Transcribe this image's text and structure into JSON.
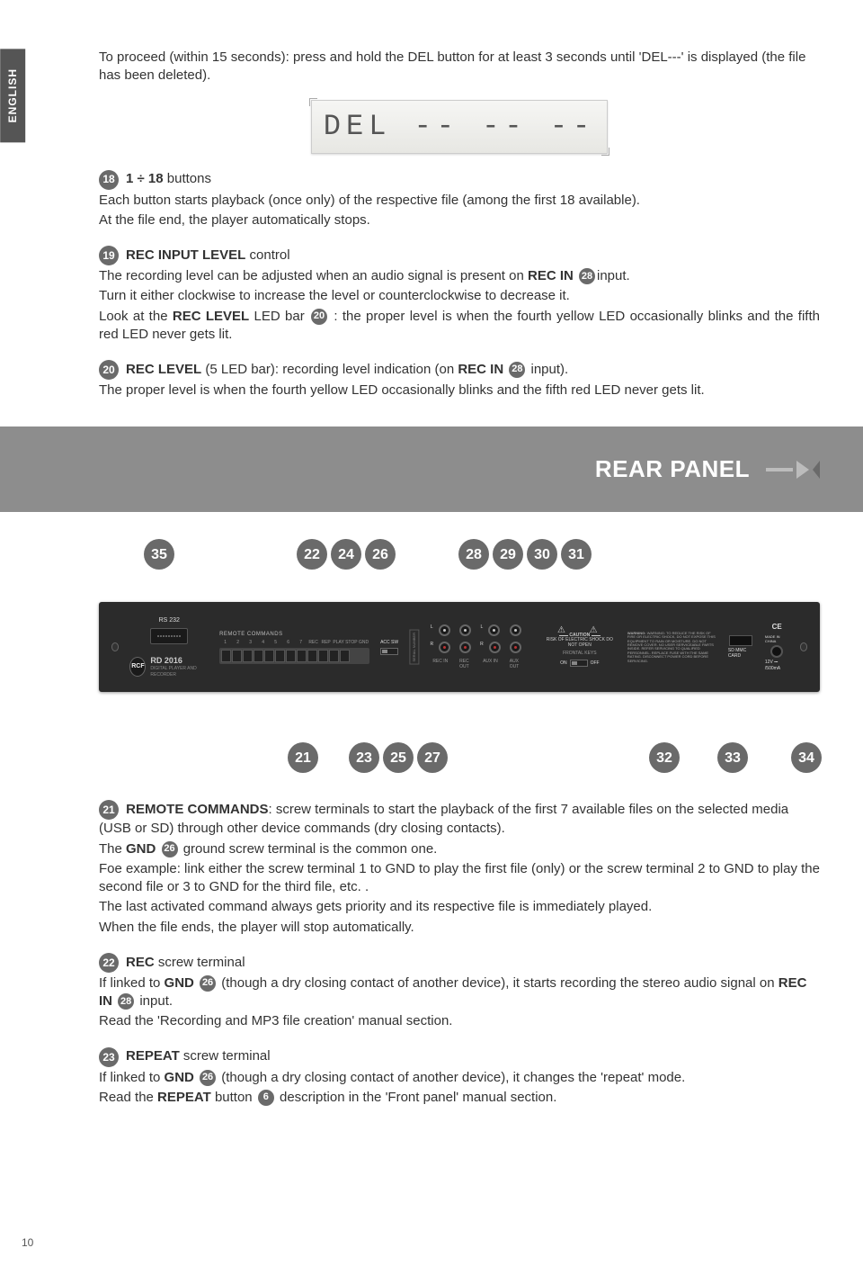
{
  "lang_tab": "ENGLISH",
  "intro": "To proceed (within 15 seconds): press and hold the DEL button for at least 3 seconds until 'DEL---' is displayed (the file has been deleted).",
  "lcd": "DEL -- -- --",
  "s18": {
    "num": "18",
    "head_a": "1 ÷ 18",
    "head_b": " buttons",
    "p1": "Each button starts playback (once only) of the respective file (among the first 18 available).",
    "p2": "At the file end, the player automatically stops."
  },
  "s19": {
    "num": "19",
    "head_a": "REC INPUT LEVEL",
    "head_b": " control",
    "p1a": "The recording level can be adjusted when an audio signal is present on ",
    "p1b": "REC IN",
    "p1ref": "28",
    "p1c": "input.",
    "p2": "Turn it either clockwise to increase the level or counterclockwise to decrease it.",
    "p3a": "Look at the ",
    "p3b": "REC LEVEL",
    "p3c": " LED bar ",
    "p3ref": "20",
    "p3d": " : the proper level is when the fourth yellow LED occasionally blinks and the fifth red LED never gets lit."
  },
  "s20": {
    "num": "20",
    "head_a": "REC LEVEL",
    "head_b": " (5 LED bar): recording level indication (on ",
    "head_c": "REC IN",
    "head_ref": "28",
    "head_d": " input).",
    "p1": "The proper level is when the fourth yellow LED occasionally blinks and the fifth red LED never gets lit."
  },
  "rear_title": "REAR PANEL",
  "top_callouts": [
    "35",
    "22",
    "24",
    "26",
    "28",
    "29",
    "30",
    "31"
  ],
  "bot_callouts": [
    "21",
    "23",
    "25",
    "27",
    "32",
    "33",
    "34"
  ],
  "device": {
    "rs232": "RS 232",
    "rcf": "RCF",
    "model": "RD 2016",
    "model_sub": "DIGITAL PLAYER AND RECORDER",
    "remote": "REMOTE COMMANDS",
    "term_nums": [
      "1",
      "2",
      "3",
      "4",
      "5",
      "6",
      "7",
      "REC",
      "REP",
      "PLAY",
      "STOP",
      "GND"
    ],
    "acc_sw": "ACC SW",
    "serial": "SERIAL NUMBER",
    "L": "L",
    "R": "R",
    "rec_in": "REC IN",
    "rec_out": "REC OUT",
    "aux_in": "AUX IN",
    "aux_out": "AUX OUT",
    "caution": "CAUTION",
    "risk": "RISK OF ELECTRIC SHOCK DO NOT OPEN",
    "warning": "WARNING: TO REDUCE THE RISK OF FIRE OR ELECTRIC SHOCK, DO NOT EXPOSE THIS EQUIPMENT TO RAIN OR MOISTURE. DO NOT REMOVE COVER. NO USER SERVICEABLE PARTS INSIDE. REFER SERVICING TO QUALIFIED PERSONNEL. REPLACE FUSE WITH THE SAME RATING. DISCONNECT POWER CORD BEFORE SERVICING.",
    "frontal": "FRONTAL KEYS",
    "on": "ON",
    "off": "OFF",
    "sd": "SD MMC CARD",
    "ce": "CE",
    "made": "MADE IN CHINA",
    "dc": "12V ⎓ /500mA"
  },
  "s21": {
    "num": "21",
    "head_a": "REMOTE COMMANDS",
    "head_b": ": screw terminals to start the playback of the first 7 available files on the selected media (USB or SD) through other device commands (dry closing contacts).",
    "p2a": "The ",
    "p2b": "GND",
    "p2ref": "26",
    "p2c": " ground screw terminal is the common one.",
    "p3": "Foe example: link either the screw terminal 1 to GND to play the first file (only) or the screw terminal 2 to GND to play the second file or 3 to GND for the third file, etc. .",
    "p4": "The last activated command always gets priority and its respective file is immediately played.",
    "p5": "When the file ends, the player will stop automatically."
  },
  "s22": {
    "num": "22",
    "head_a": "REC",
    "head_b": " screw terminal",
    "p1a": "If linked to ",
    "p1b": "GND",
    "p1ref": "26",
    "p1c": " (though a dry closing contact of another device), it starts recording the stereo audio signal on ",
    "p1d": "REC IN",
    "p1ref2": "28",
    "p1e": " input.",
    "p2": "Read the 'Recording and MP3 file creation' manual section."
  },
  "s23": {
    "num": "23",
    "head_a": "REPEAT",
    "head_b": " screw terminal",
    "p1a": "If linked to ",
    "p1b": "GND",
    "p1ref": "26",
    "p1c": " (though a dry closing contact of another device), it changes the 'repeat' mode.",
    "p2a": "Read the ",
    "p2b": "REPEAT",
    "p2c": " button ",
    "p2ref": "6",
    "p2d": " description in the 'Front panel' manual section."
  },
  "page_num": "10"
}
